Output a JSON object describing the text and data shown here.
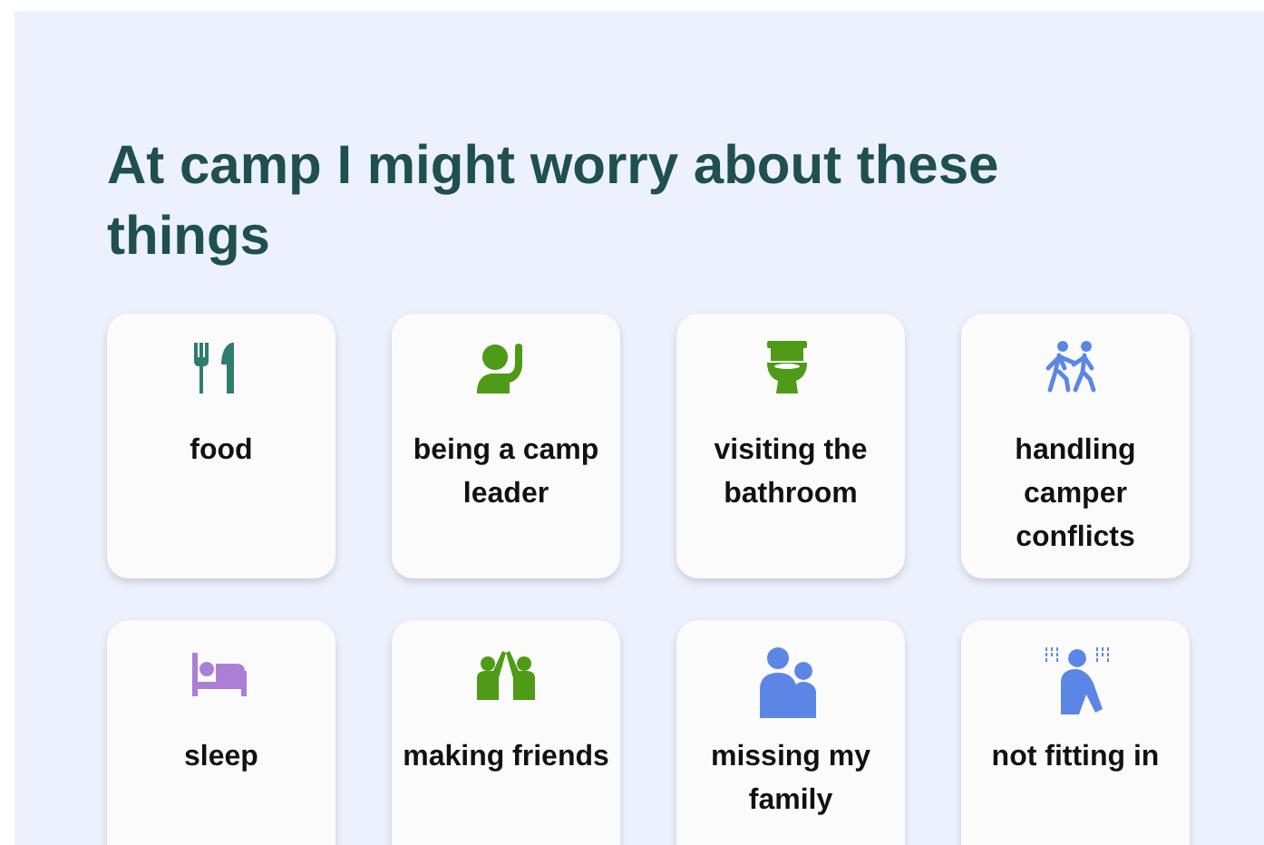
{
  "title": "At camp I might worry about these things",
  "items": [
    {
      "label": "food",
      "kind": "utensils",
      "color": "#2e7d6e"
    },
    {
      "label": "being a camp leader",
      "kind": "raised-hand",
      "color": "#4f9a16"
    },
    {
      "label": "visiting the bathroom",
      "kind": "toilet",
      "color": "#4f9a16"
    },
    {
      "label": "handling camper conflicts",
      "kind": "conflict",
      "color": "#5b86e5"
    },
    {
      "label": "sleep",
      "kind": "bed",
      "color": "#ab7fd6"
    },
    {
      "label": "making friends",
      "kind": "high-five",
      "color": "#4f9a16"
    },
    {
      "label": "missing my family",
      "kind": "family",
      "color": "#5b86e5"
    },
    {
      "label": "not fitting in",
      "kind": "alone",
      "color": "#5b86e5"
    }
  ]
}
